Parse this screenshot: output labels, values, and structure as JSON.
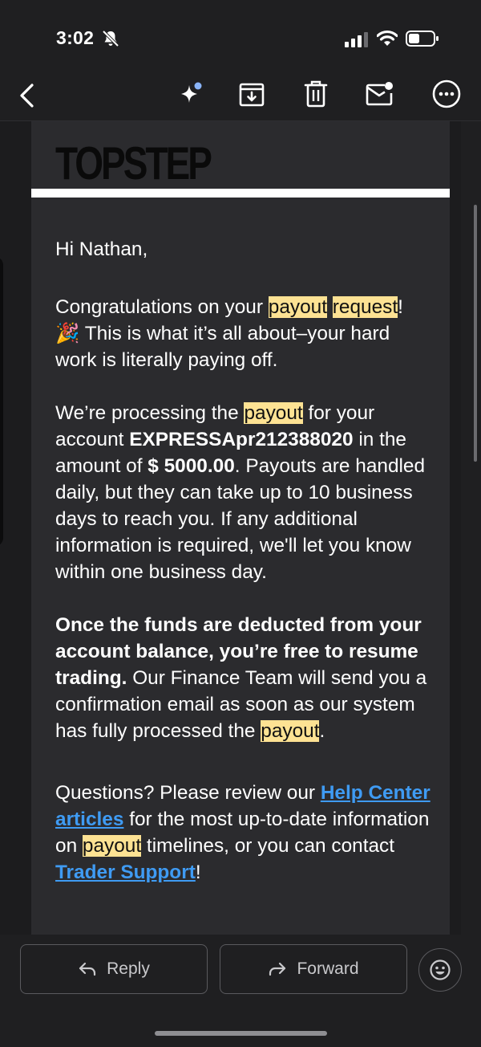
{
  "status": {
    "time": "3:02"
  },
  "toolbar": {
    "icons": [
      "back-icon",
      "sparkle-icon",
      "archive-icon",
      "trash-icon",
      "mark-unread-icon",
      "more-icon"
    ]
  },
  "email": {
    "logo": "TOPSTEP",
    "greeting": "Hi Nathan,",
    "p1": {
      "before": "Congratulations on your ",
      "hl1": "payout",
      "space": " ",
      "hl2": "request",
      "after": "! 🎉 This is what it’s all about–your hard work is literally paying off."
    },
    "p2": {
      "before": "We’re processing the ",
      "hl": "payout",
      "mid1": " for your account ",
      "account": "EXPRESSApr212388020",
      "mid2": " in the amount of ",
      "amount": "$ 5000.00",
      "after": ". Payouts are handled daily, but they can take up to 10 business days to reach you. If any additional information is required, we'll let you know within one business day."
    },
    "p3": {
      "bold": "Once the funds are deducted from your account balance, you’re free to resume trading.",
      "mid": " Our Finance Team will send you a confirmation email as soon as our system has fully processed the ",
      "hl": "payout",
      "after": "."
    },
    "p4": {
      "before": "Questions? Please review our ",
      "link1": "Help Center articles",
      "mid1": " for the most up-to-date information on ",
      "hl": "payout",
      "mid2": " timelines, or you can contact ",
      "link2": "Trader Support",
      "after": "!"
    }
  },
  "actions": {
    "reply_label": "Reply",
    "forward_label": "Forward"
  }
}
